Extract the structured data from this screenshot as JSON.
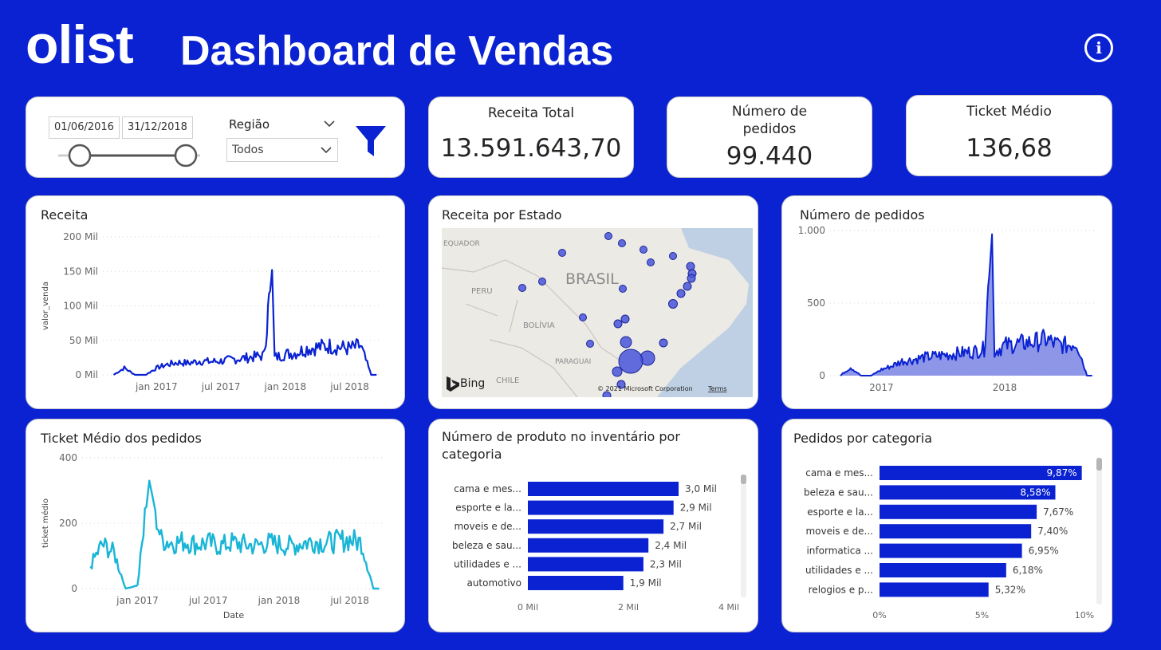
{
  "header": {
    "logo": "olist",
    "title": "Dashboard de Vendas",
    "info_icon": "info-circle-icon"
  },
  "filters": {
    "date_start": "01/06/2016",
    "date_end": "31/12/2018",
    "region_label": "Região",
    "region_value": "Todos",
    "filter_icon": "funnel-icon"
  },
  "kpis": {
    "receita_label": "Receita Total",
    "receita_value": "13.591.643,70",
    "pedidos_label_line1": "Número de",
    "pedidos_label_line2": "pedidos",
    "pedidos_value": "99.440",
    "ticket_label": "Ticket Médio",
    "ticket_value": "136,68"
  },
  "colors": {
    "background": "#0A22D2",
    "bar": "#0A22D2",
    "ticket_line": "#19B5D6",
    "area": "#8E96E8"
  },
  "map": {
    "title": "Receita por Estado",
    "labels": {
      "brasil": "BRASIL",
      "peru": "PERU",
      "bolivia": "BOLÍVIA",
      "equador": "EQUADOR",
      "paraguai": "PARAGUAI",
      "chile": "CHILE"
    },
    "bing": "Bing",
    "copyright": "© 2021 Microsoft Corporation",
    "terms": "Terms"
  },
  "chart_data": [
    {
      "type": "line",
      "title": "Receita",
      "xlabel": "",
      "ylabel": "valor_venda",
      "ylim": [
        0,
        200000
      ],
      "yticks": [
        "0 Mil",
        "50 Mil",
        "100 Mil",
        "150 Mil",
        "200 Mil"
      ],
      "xticks": [
        "jan 2017",
        "jul 2017",
        "jan 2018",
        "jul 2018"
      ],
      "x": [
        "2016-09",
        "2016-10",
        "2016-11",
        "2016-12",
        "2017-01",
        "2017-02",
        "2017-03",
        "2017-04",
        "2017-05",
        "2017-06",
        "2017-07",
        "2017-08",
        "2017-09",
        "2017-10",
        "2017-11",
        "2017-11-24",
        "2017-12",
        "2018-01",
        "2018-02",
        "2018-03",
        "2018-04",
        "2018-05",
        "2018-06",
        "2018-07",
        "2018-08",
        "2018-09"
      ],
      "values": [
        0,
        10000,
        0,
        0,
        10000,
        15000,
        18000,
        17000,
        20000,
        19000,
        20000,
        22000,
        24000,
        26000,
        28000,
        152000,
        25000,
        30000,
        32000,
        38000,
        40000,
        42000,
        40000,
        38000,
        42000,
        0
      ]
    },
    {
      "type": "line",
      "title": "Ticket Médio dos pedidos",
      "xlabel": "Date",
      "ylabel": "ticket médio",
      "ylim": [
        0,
        400
      ],
      "yticks": [
        "0",
        "200",
        "400"
      ],
      "xticks": [
        "jan 2017",
        "jul 2017",
        "jan 2018",
        "jul 2018"
      ],
      "x": [
        "2016-09",
        "2016-10",
        "2016-11",
        "2016-12",
        "2017-01",
        "2017-02",
        "2017-03",
        "2017-04",
        "2017-05",
        "2017-06",
        "2017-07",
        "2017-08",
        "2017-09",
        "2017-10",
        "2017-11",
        "2017-12",
        "2018-01",
        "2018-02",
        "2018-03",
        "2018-04",
        "2018-05",
        "2018-06",
        "2018-07",
        "2018-08",
        "2018-09"
      ],
      "values": [
        70,
        135,
        110,
        0,
        10,
        330,
        150,
        140,
        145,
        135,
        140,
        130,
        140,
        135,
        130,
        140,
        135,
        130,
        140,
        145,
        140,
        145,
        150,
        140,
        0
      ]
    },
    {
      "type": "area",
      "title": "Número de pedidos",
      "ylim": [
        0,
        1200
      ],
      "yticks": [
        "0",
        "500",
        "1.000"
      ],
      "xticks": [
        "2017",
        "2018"
      ],
      "x": [
        "2016-09",
        "2016-10",
        "2016-11",
        "2016-12",
        "2017-01",
        "2017-02",
        "2017-03",
        "2017-04",
        "2017-05",
        "2017-06",
        "2017-07",
        "2017-08",
        "2017-09",
        "2017-10",
        "2017-11",
        "2017-11-24",
        "2017-12",
        "2018-01",
        "2018-02",
        "2018-03",
        "2018-04",
        "2018-05",
        "2018-06",
        "2018-07",
        "2018-08",
        "2018-09"
      ],
      "values": [
        0,
        70,
        0,
        0,
        50,
        80,
        120,
        130,
        150,
        160,
        170,
        180,
        190,
        200,
        220,
        1170,
        200,
        250,
        260,
        270,
        280,
        300,
        260,
        250,
        280,
        0
      ]
    },
    {
      "type": "bar",
      "title": "Número de produto no inventário por categoria",
      "categories": [
        "cama e mes...",
        "esporte e la...",
        "moveis e de...",
        "beleza e sau...",
        "utilidades e ...",
        "automotivo"
      ],
      "values": [
        3000,
        2900,
        2700,
        2400,
        2300,
        1900
      ],
      "data_labels": [
        "3,0 Mil",
        "2,9 Mil",
        "2,7 Mil",
        "2,4 Mil",
        "2,3 Mil",
        "1,9 Mil"
      ],
      "xlim": [
        0,
        4000
      ],
      "xticks": [
        "0 Mil",
        "2 Mil",
        "4 Mil"
      ]
    },
    {
      "type": "bar",
      "title": "Pedidos por categoria",
      "categories": [
        "cama e mes...",
        "beleza e sau...",
        "esporte e la...",
        "moveis e de...",
        "informatica ...",
        "utilidades e ...",
        "relogios e p..."
      ],
      "values": [
        9.87,
        8.58,
        7.67,
        7.4,
        6.95,
        6.18,
        5.32
      ],
      "data_labels": [
        "9,87%",
        "8,58%",
        "7,67%",
        "7,40%",
        "6,95%",
        "6,18%",
        "5,32%"
      ],
      "xlim": [
        0,
        10
      ],
      "xticks": [
        "0%",
        "5%",
        "10%"
      ]
    }
  ]
}
